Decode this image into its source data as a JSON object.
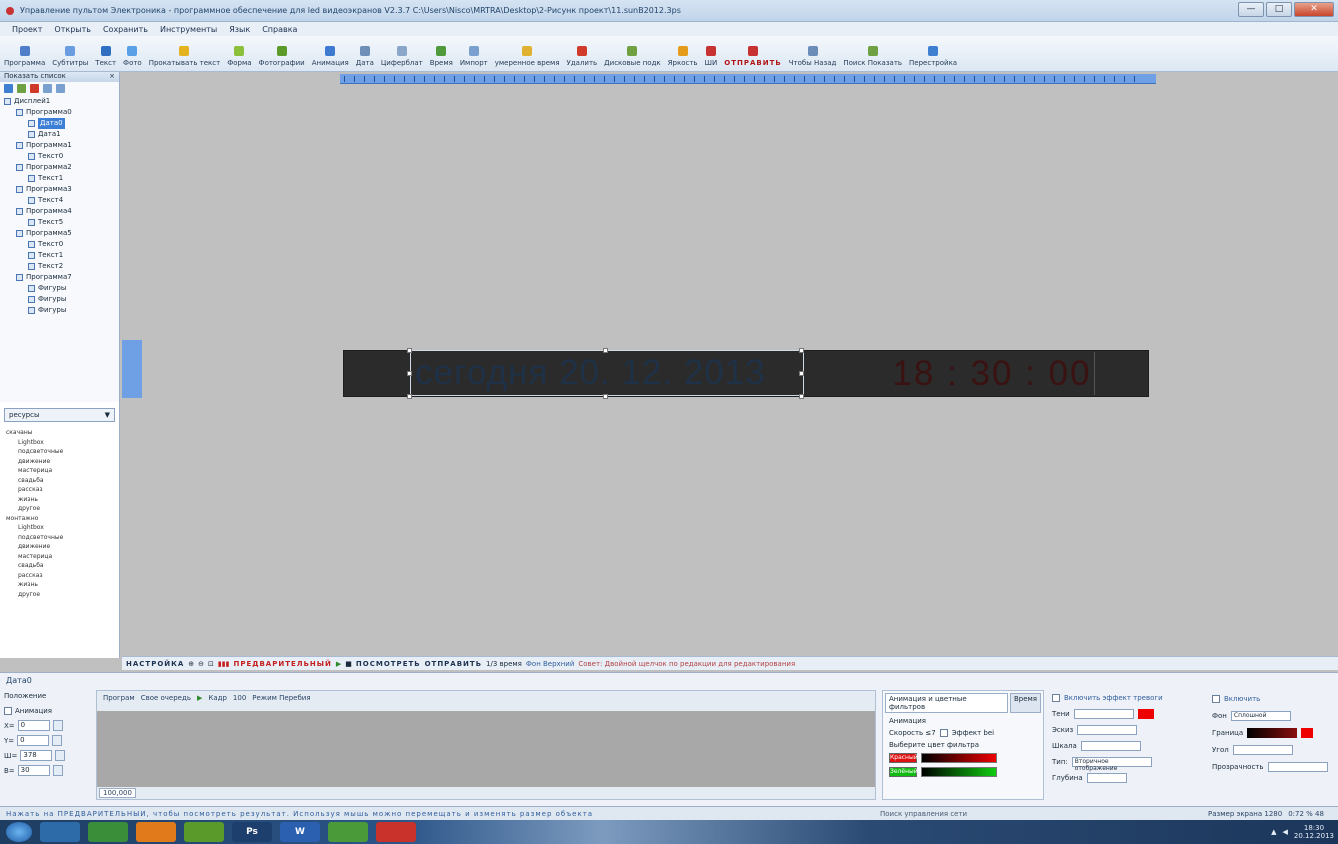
{
  "window": {
    "title": "Управление пультом Электроника - программное обеспечение для led видеоэкранов V2.3.7 C:\\Users\\Nisco\\MRTRA\\Desktop\\2-Рисунк проект\\11.sunB2012.3ps",
    "minimize": "—",
    "maximize": "□",
    "close": "✕"
  },
  "menu": [
    "Проект",
    "Открыть",
    "Сохранить",
    "Инструменты",
    "Язык",
    "Справка"
  ],
  "toolbar": [
    {
      "label": "Программа",
      "icon": "program-icon",
      "color": "#4f7fc9"
    },
    {
      "label": "Субтитры",
      "icon": "subtitles-icon",
      "color": "#6a9de0"
    },
    {
      "label": "Текст",
      "icon": "text-icon",
      "color": "#2f6fc0"
    },
    {
      "label": "Фото",
      "icon": "photo-icon",
      "color": "#5aa0e6"
    },
    {
      "label": "Прокатывать текст",
      "icon": "scroll-text-icon",
      "color": "#e6b320"
    },
    {
      "label": "Форма",
      "icon": "form-icon",
      "color": "#8cbf3a"
    },
    {
      "label": "Фотографии",
      "icon": "photos-icon",
      "color": "#5c9a2a"
    },
    {
      "label": "Анимация",
      "icon": "animation-icon",
      "color": "#3e7ad0"
    },
    {
      "label": "Дата",
      "icon": "date-icon",
      "color": "#6f8fb8"
    },
    {
      "label": "Циферблат",
      "icon": "clock-icon",
      "color": "#8aa6c8"
    },
    {
      "label": "Время",
      "icon": "time-icon",
      "color": "#4f9a3a"
    },
    {
      "label": "Импорт",
      "icon": "import-icon",
      "color": "#7aa0cf"
    },
    {
      "label": "умеренное время",
      "icon": "timer-icon",
      "color": "#e0b130"
    },
    {
      "label": "Удалить",
      "icon": "delete-icon",
      "color": "#d03a2a"
    },
    {
      "label": "Дисковые подк",
      "icon": "disk-icon",
      "color": "#6fa042"
    },
    {
      "label": "Яркость",
      "icon": "brightness-icon",
      "color": "#e59c1a"
    },
    {
      "label": "ШИ",
      "icon": "settings-icon",
      "color": "#c83232"
    },
    {
      "label": "ОТПРАВИТЬ",
      "icon": "send-icon",
      "color": "#c83232",
      "bold": true
    },
    {
      "label": "Чтобы Назад",
      "icon": "back-icon",
      "color": "#6b8db8"
    },
    {
      "label": "Поиск Показать",
      "icon": "search-show-icon",
      "color": "#6fa042"
    },
    {
      "label": "Перестройка",
      "icon": "rebuild-icon",
      "color": "#3f7fd1"
    }
  ],
  "left_panel": {
    "title": "Показать список",
    "pin": "×",
    "tree": [
      {
        "label": "Дисплей1",
        "level": 0
      },
      {
        "label": "Программа0",
        "level": 1
      },
      {
        "label": "Дата0",
        "level": 2,
        "selected": true
      },
      {
        "label": "Дата1",
        "level": 2
      },
      {
        "label": "Программа1",
        "level": 1
      },
      {
        "label": "Текст0",
        "level": 2
      },
      {
        "label": "Программа2",
        "level": 1
      },
      {
        "label": "Текст1",
        "level": 2
      },
      {
        "label": "Программа3",
        "level": 1
      },
      {
        "label": "Текст4",
        "level": 2
      },
      {
        "label": "Программа4",
        "level": 1
      },
      {
        "label": "Текст5",
        "level": 2
      },
      {
        "label": "Программа5",
        "level": 1
      },
      {
        "label": "Текст0",
        "level": 2
      },
      {
        "label": "Текст1",
        "level": 2
      },
      {
        "label": "Текст2",
        "level": 2
      },
      {
        "label": "Программа7",
        "level": 1
      },
      {
        "label": "Фигуры",
        "level": 2
      },
      {
        "label": "Фигуры",
        "level": 2
      },
      {
        "label": "Фигуры",
        "level": 2
      }
    ]
  },
  "effects": {
    "dropdown": "ресурсы",
    "groups": [
      {
        "name": "скачаны",
        "items": [
          "Lightbox",
          "подсветочные",
          "движение",
          "мастерица",
          "свадьба",
          "рассказ",
          "жизнь",
          "другое"
        ]
      },
      {
        "name": "монтажно",
        "items": [
          "Lightbox",
          "подсветочные",
          "движение",
          "мастерица",
          "свадьба",
          "рассказ",
          "жизнь",
          "другое"
        ]
      }
    ]
  },
  "led": {
    "text": "сегодня 20. 12. 2013",
    "clock": "18 : 30 : 00",
    "text_color": "#1e3147",
    "clock_color": "#3a1212"
  },
  "control_bar": {
    "label_left": "НАСТРОЙКА",
    "preview": "ПРЕДВАРИТЕЛЬНЫЙ",
    "view": "ПОСМОТРЕТЬ",
    "send": "ОТПРАВИТЬ",
    "frames": "1/3 время",
    "bg": "Фон Верхний",
    "status": "Совет: Двойной щелчок по редакции для редактирования"
  },
  "bottom": {
    "title": "Дата0",
    "subtitle": "Положение",
    "props": [
      {
        "label": "X=",
        "value": "0"
      },
      {
        "label": "Y=",
        "value": "0"
      },
      {
        "label": "Ш=",
        "value": "378"
      },
      {
        "label": "В=",
        "value": "30"
      }
    ],
    "anim_checkbox": "Анимация",
    "timeline_bar": [
      "Програм",
      "Свое очередь",
      "Кадр",
      "100",
      "Режим Перебия"
    ],
    "timeline_foot": [
      "100,000"
    ],
    "anim_tabs": [
      "Анимация и цветные фильтров",
      "Время"
    ],
    "anim_label": "Анимация",
    "speed_label": "Скорость ≤7",
    "speed_check": "Эффект bei",
    "filter_label": "Выберите цвет фильтра",
    "swatch1": "Красный",
    "swatch2": "Зелёный",
    "shadow_title": "Включить эффект тревоги",
    "shadow_rows": [
      "Тени",
      "Эскиз",
      "Шкала"
    ],
    "shadow_type": "Тип:",
    "shadow_value": "Вторичное отображение",
    "depth_label": "Глубина",
    "bg_title": "Включить",
    "bg_rows": [
      "Фон",
      "Граница",
      "Угол",
      "Прозрачность"
    ],
    "bg_value": "Сплошной"
  },
  "status": {
    "hint": "Нажать на ПРЕДВАРИТЕЛЬНЫЙ, чтобы посмотреть результат. Используя мышь можно перемещать и изменять размер объекта",
    "mid": "Поиск управления сети",
    "right1": "Размер экрана 1280",
    "right2": "0:72 % 48"
  },
  "taskbar": {
    "apps": [
      "",
      "",
      "",
      "",
      "Ps",
      "W",
      "",
      ""
    ],
    "time": "18:30",
    "date": "20.12.2013"
  }
}
